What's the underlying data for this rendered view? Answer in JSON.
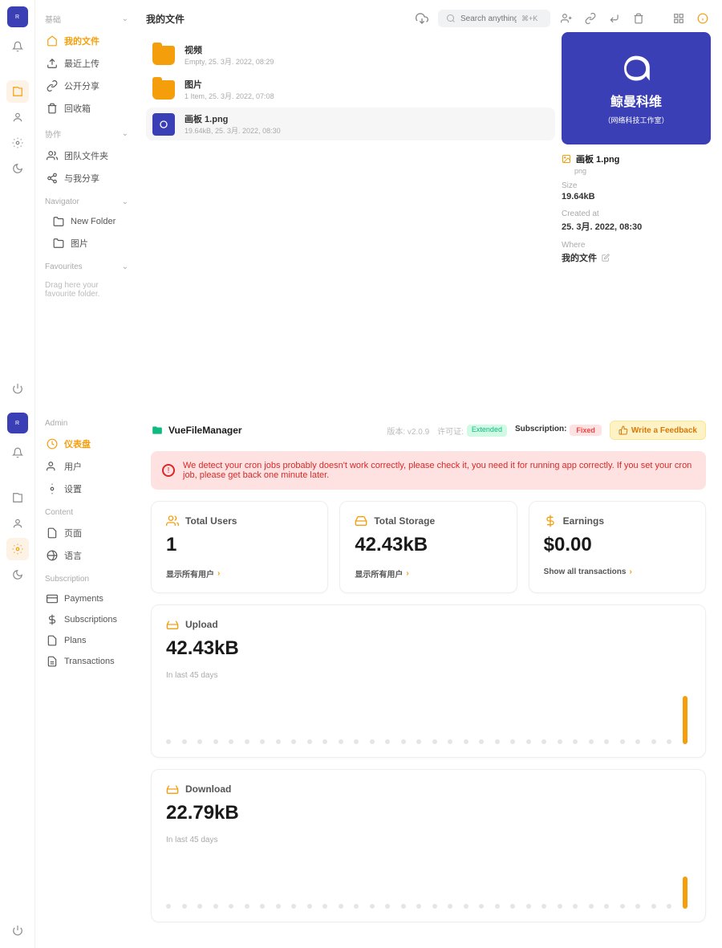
{
  "fm": {
    "title": "我的文件",
    "search": {
      "placeholder": "Search anything...",
      "kbd": "⌘+K"
    },
    "sidebar": {
      "sec_basic": "基础",
      "sec_collab": "协作",
      "sec_nav": "Navigator",
      "sec_fav": "Favourites",
      "items": {
        "my_files": "我的文件",
        "recent": "最近上传",
        "public": "公开分享",
        "trash": "回收箱",
        "team": "团队文件夹",
        "shared": "与我分享",
        "new_folder": "New Folder",
        "pictures": "图片"
      },
      "fav_placeholder": "Drag here your favourite folder."
    },
    "files": [
      {
        "name": "视频",
        "meta": "Empty, 25. 3月. 2022, 08:29",
        "type": "folder"
      },
      {
        "name": "图片",
        "meta": "1 Item, 25. 3月. 2022, 07:08",
        "type": "folder"
      },
      {
        "name": "画板 1.png",
        "meta": "19.64kB, 25. 3月. 2022, 08:30",
        "type": "image"
      }
    ],
    "detail": {
      "brand_name": "鲸曼科维",
      "brand_sub": "（网络科技工作室）",
      "name": "画板 1.png",
      "ext": "png",
      "size_label": "Size",
      "size": "19.64kB",
      "created_label": "Created at",
      "created": "25. 3月. 2022, 08:30",
      "where_label": "Where",
      "where": "我的文件"
    }
  },
  "admin": {
    "brand": "VueFileManager",
    "version": "版本: v2.0.9",
    "license_label": "许可证:",
    "license_status": "Extended",
    "sub_label": "Subscription:",
    "sub_status": "Fixed",
    "feedback": "Write a Feedback",
    "warn": "We detect your cron jobs probably doesn't work correctly, please check it, you need it for running app correctly. If you set your cron job, please get back one minute later.",
    "sidebar": {
      "sec_admin": "Admin",
      "sec_content": "Content",
      "sec_sub": "Subscription",
      "dashboard": "仪表盘",
      "users": "用户",
      "settings": "设置",
      "pages": "页面",
      "language": "语言",
      "payments": "Payments",
      "subscriptions": "Subscriptions",
      "plans": "Plans",
      "transactions": "Transactions"
    },
    "cards": {
      "users_title": "Total Users",
      "users_val": "1",
      "users_link": "显示所有用户",
      "storage_title": "Total Storage",
      "storage_val": "42.43kB",
      "storage_link": "显示所有用户",
      "earn_title": "Earnings",
      "earn_val": "$0.00",
      "earn_link": "Show all transactions"
    },
    "upload": {
      "title": "Upload",
      "val": "42.43kB",
      "sub": "In last 45 days"
    },
    "download": {
      "title": "Download",
      "val": "22.79kB",
      "sub": "In last 45 days"
    }
  }
}
